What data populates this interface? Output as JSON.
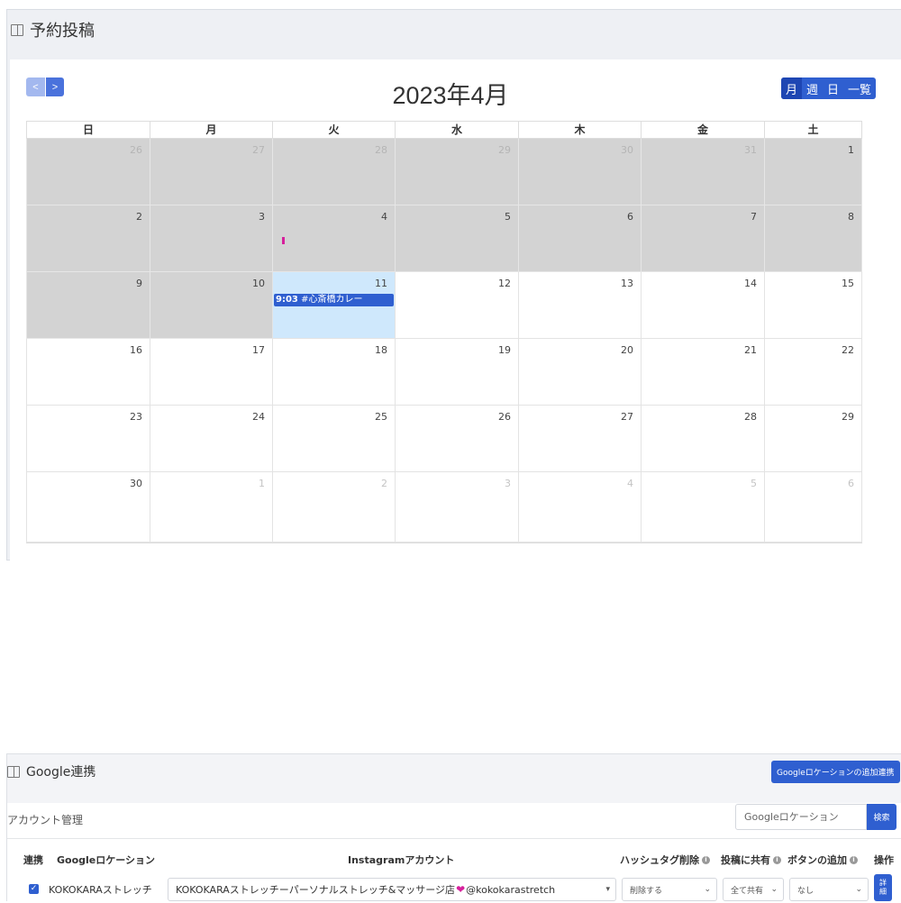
{
  "reservation": {
    "title": "予約投稿",
    "prev_label": "<",
    "next_label": ">",
    "month_title": "2023年4月",
    "views": [
      "月",
      "週",
      "日",
      "一覧"
    ],
    "weekdays": [
      "日",
      "月",
      "火",
      "水",
      "木",
      "金",
      "土"
    ],
    "weeks": [
      [
        "26",
        "27",
        "28",
        "29",
        "30",
        "31",
        "1"
      ],
      [
        "2",
        "3",
        "4",
        "5",
        "6",
        "7",
        "8"
      ],
      [
        "9",
        "10",
        "11",
        "12",
        "13",
        "14",
        "15"
      ],
      [
        "16",
        "17",
        "18",
        "19",
        "20",
        "21",
        "22"
      ],
      [
        "23",
        "24",
        "25",
        "26",
        "27",
        "28",
        "29"
      ],
      [
        "30",
        "1",
        "2",
        "3",
        "4",
        "5",
        "6"
      ]
    ],
    "event": {
      "time": "9:03",
      "title": "#心斎橋カレー"
    }
  },
  "google": {
    "title": "Google連携",
    "add_button": "Googleロケーションの追加連携",
    "account_label": "アカウント管理",
    "search_placeholder": "Googleロケーション",
    "search_button": "検索",
    "columns": {
      "link": "連携",
      "location": "Googleロケーション",
      "instagram": "Instagramアカウント",
      "hashtag": "ハッシュタグ削除",
      "share": "投稿に共有",
      "button": "ボタンの追加",
      "ops": "操作"
    },
    "row": {
      "location": "KOKOKARAストレッチ",
      "instagram_name": "KOKOKARAストレッチーパーソナルストレッチ&マッサージ店",
      "instagram_handle": "@kokokarastretch",
      "hashtag_value": "削除する",
      "share_value": "全て共有",
      "button_value": "なし",
      "detail_line1": "詳",
      "detail_line2": "細"
    }
  },
  "colors": {
    "primary": "#2f5fd0",
    "past_cell": "#d3d3d3",
    "today_cell": "#cfe8fc",
    "marker": "#d6209c"
  }
}
